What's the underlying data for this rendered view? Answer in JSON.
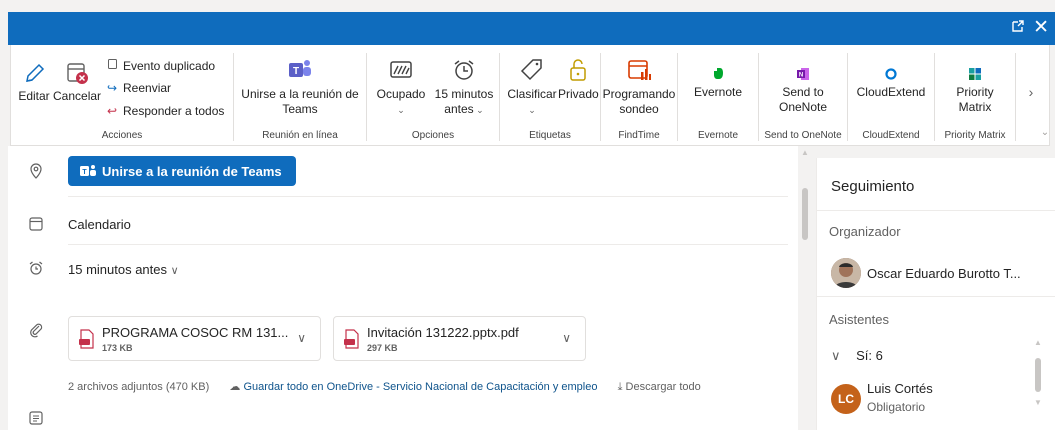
{
  "window": {
    "popout_icon": "popout-icon",
    "close_icon": "close-icon"
  },
  "ribbon": {
    "acciones": {
      "label": "Acciones",
      "editar": "Editar",
      "cancelar": "Cancelar",
      "evento_duplicado": "Evento duplicado",
      "reenviar": "Reenviar",
      "responder_todos": "Responder a todos"
    },
    "reunion": {
      "label": "Reunión en línea",
      "unirse_1": "Unirse a la reunión de",
      "unirse_2": "Teams"
    },
    "opciones": {
      "label": "Opciones",
      "ocupado": "Ocupado",
      "minutos_1": "15 minutos",
      "minutos_2": "antes"
    },
    "etiquetas": {
      "label": "Etiquetas",
      "clasificar": "Clasificar",
      "privado": "Privado"
    },
    "findtime": {
      "label": "FindTime",
      "programando_1": "Programando",
      "programando_2": "sondeo"
    },
    "evernote": {
      "label": "Evernote",
      "button": "Evernote"
    },
    "onenote": {
      "label": "Send to OneNote",
      "button_1": "Send to",
      "button_2": "OneNote"
    },
    "cloudextend": {
      "label": "CloudExtend",
      "button": "CloudExtend"
    },
    "priority": {
      "label": "Priority Matrix",
      "button_1": "Priority",
      "button_2": "Matrix"
    }
  },
  "event": {
    "join_button": "Unirse a la reunión de Teams",
    "calendar": "Calendario",
    "reminder": "15 minutos antes",
    "attachments": [
      {
        "name": "PROGRAMA COSOC RM 131...",
        "size": "173 KB"
      },
      {
        "name": "Invitación 131222.pptx.pdf",
        "size": "297 KB"
      }
    ],
    "attach_summary": "2 archivos adjuntos (470 KB)",
    "save_onedrive": "Guardar todo en OneDrive - Servicio Nacional de Capacitación y empleo",
    "download_all": "Descargar todo"
  },
  "tracking": {
    "title": "Seguimiento",
    "organizer_label": "Organizador",
    "organizer_name": "Oscar Eduardo Burotto T...",
    "attendees_label": "Asistentes",
    "yes_group": "Sí: 6",
    "attendee_initials": "LC",
    "attendee_name": "Luis Cortés",
    "attendee_role": "Obligatorio"
  },
  "colors": {
    "accent": "#0f6cbd",
    "danger": "#c4314b",
    "teams": "#5b5fc7",
    "findtime": "#d83b01",
    "evernote": "#00a82d",
    "onenote": "#7719aa",
    "cloudextend": "#0078d4",
    "priority": "#1aa0a0",
    "avatar_lc": "#c4621a"
  }
}
